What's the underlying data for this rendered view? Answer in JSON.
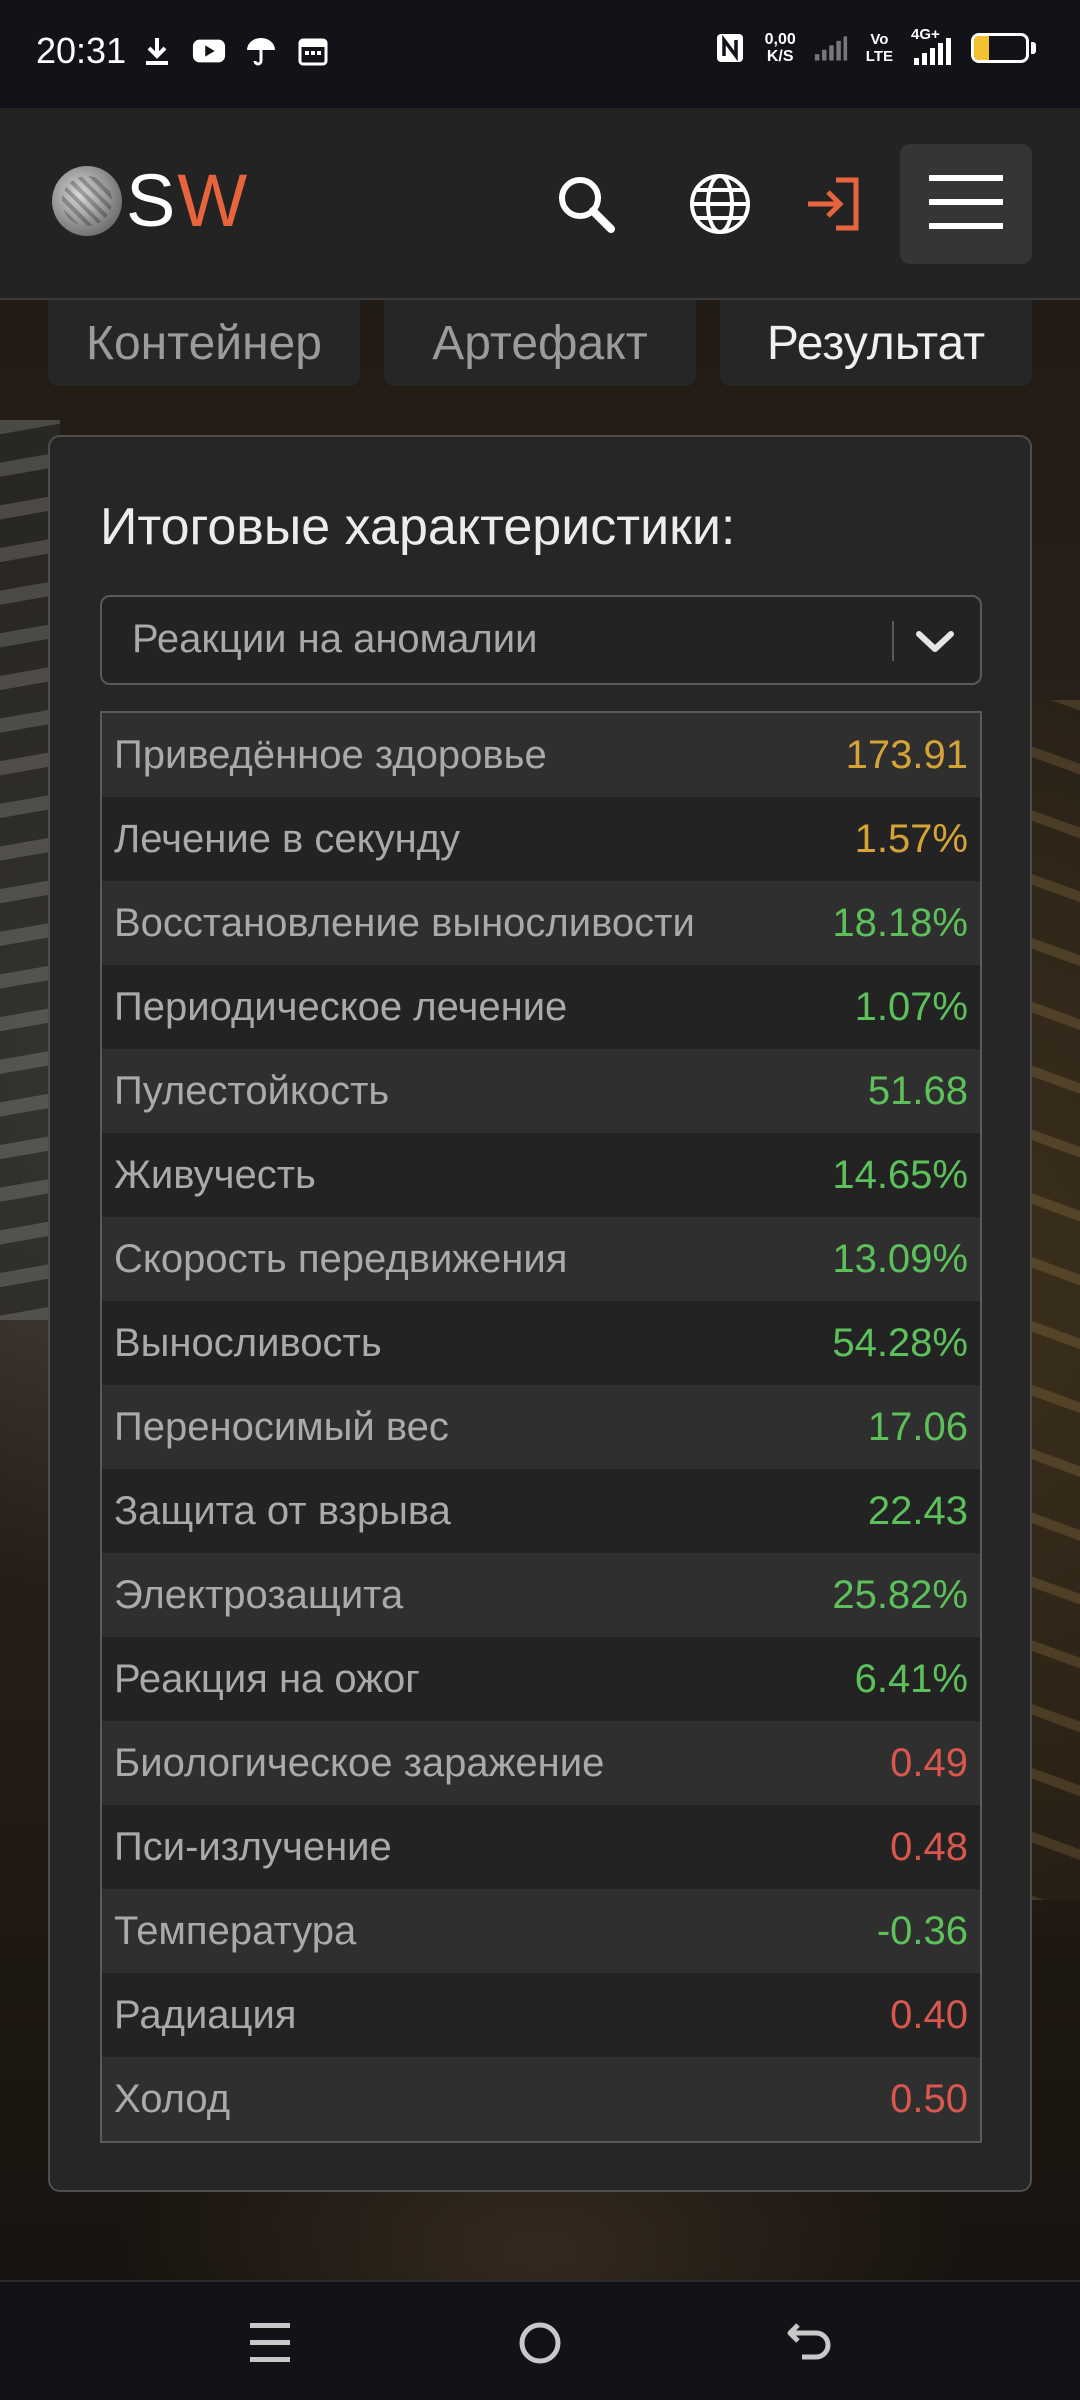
{
  "status_bar": {
    "time": "20:31",
    "net_speed_value": "0,00",
    "net_speed_unit": "K/S",
    "volte_top": "Vo",
    "volte_bottom": "LTE",
    "network_type": "4G+",
    "battery_level": "28",
    "battery_fraction": 0.28,
    "left_icons": [
      "download-icon",
      "youtube-icon",
      "umbrella-icon",
      "calendar-icon"
    ],
    "right_icons": [
      "nfc-icon",
      "signal-weak-icon",
      "signal-strong-icon",
      "battery-icon"
    ]
  },
  "header": {
    "logo_s": "S",
    "logo_w": "W",
    "icons": [
      "search-icon",
      "globe-icon",
      "login-icon",
      "menu-icon"
    ],
    "accent_color": "#e8643c"
  },
  "tabs": [
    {
      "label": "Контейнер",
      "active": false
    },
    {
      "label": "Артефакт",
      "active": false
    },
    {
      "label": "Результат",
      "active": true
    }
  ],
  "panel": {
    "title": "Итоговые характеристики:",
    "select_value": "Реакции на аномалии",
    "colors": {
      "yellow": "#d6a436",
      "green": "#5cc15a",
      "red": "#d9574c"
    },
    "stats": [
      {
        "name": "Приведённое здоровье",
        "value": "173.91",
        "color": "#d6a436"
      },
      {
        "name": "Лечение в секунду",
        "value": "1.57%",
        "color": "#d6a436"
      },
      {
        "name": "Восстановление выносливости",
        "value": "18.18%",
        "color": "#5cc15a"
      },
      {
        "name": "Периодическое лечение",
        "value": "1.07%",
        "color": "#5cc15a"
      },
      {
        "name": "Пулестойкость",
        "value": "51.68",
        "color": "#5cc15a"
      },
      {
        "name": "Живучесть",
        "value": "14.65%",
        "color": "#5cc15a"
      },
      {
        "name": "Скорость передвижения",
        "value": "13.09%",
        "color": "#5cc15a"
      },
      {
        "name": "Выносливость",
        "value": "54.28%",
        "color": "#5cc15a"
      },
      {
        "name": "Переносимый вес",
        "value": "17.06",
        "color": "#5cc15a"
      },
      {
        "name": "Защита от взрыва",
        "value": "22.43",
        "color": "#5cc15a"
      },
      {
        "name": "Электрозащита",
        "value": "25.82%",
        "color": "#5cc15a"
      },
      {
        "name": "Реакция на ожог",
        "value": "6.41%",
        "color": "#5cc15a"
      },
      {
        "name": "Биологическое заражение",
        "value": "0.49",
        "color": "#d9574c"
      },
      {
        "name": "Пси-излучение",
        "value": "0.48",
        "color": "#d9574c"
      },
      {
        "name": "Температура",
        "value": "-0.36",
        "color": "#5cc15a"
      },
      {
        "name": "Радиация",
        "value": "0.40",
        "color": "#d9574c"
      },
      {
        "name": "Холод",
        "value": "0.50",
        "color": "#d9574c"
      }
    ]
  },
  "nav_bar": {
    "buttons": [
      "recent-apps-icon",
      "home-icon",
      "back-icon"
    ]
  }
}
